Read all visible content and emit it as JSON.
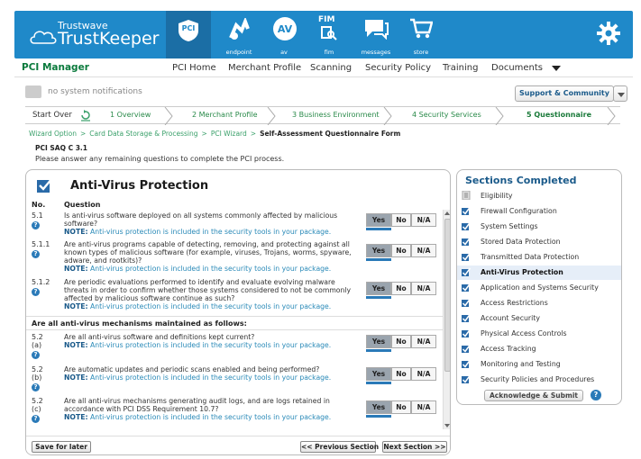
{
  "header": {
    "logo_line1": "Trustwave",
    "logo_line2": "TrustKeeper",
    "nav_icons": [
      {
        "label": "",
        "icon": "pci-shield-icon"
      },
      {
        "label": "endpoint",
        "icon": "endpoint-icon"
      },
      {
        "label": "av",
        "icon": "av-icon"
      },
      {
        "label": "fim",
        "icon": "fim-icon"
      },
      {
        "label": "messages",
        "icon": "messages-icon"
      },
      {
        "label": "store",
        "icon": "cart-icon"
      }
    ],
    "pci_text": "PCI",
    "av_text": "AV",
    "fim_text": "FIM"
  },
  "mainnav": {
    "brand": "PCI Manager",
    "items": [
      "PCI Home",
      "Merchant Profile",
      "Scanning",
      "Security Policy",
      "Training",
      "Documents"
    ]
  },
  "notifications": {
    "text": "no system notifications",
    "support_label": "Support & Community"
  },
  "steps": {
    "start_over": "Start Over",
    "items": [
      "1 Overview",
      "2 Merchant Profile",
      "3 Business Environment",
      "4 Security Services",
      "5 Questionnaire"
    ]
  },
  "crumbs": {
    "items": [
      "Wizard Option",
      "Card Data Storage & Processing",
      "PCI Wizard"
    ],
    "current": "Self-Assessment Questionnaire Form"
  },
  "saq_label": "PCI SAQ C 3.1",
  "instructions": "Please answer any remaining questions to complete the PCI process.",
  "questions_panel": {
    "title": "Anti-Virus Protection",
    "col_no": "No.",
    "col_question": "Question",
    "subheading": "Are all anti-virus mechanisms maintained as follows:",
    "note_label": "NOTE:",
    "answer_labels": [
      "Yes",
      "No",
      "N/A"
    ],
    "questions": [
      {
        "num": "5.1",
        "text": "Is anti-virus software deployed on all systems commonly affected by malicious software?",
        "note": "Anti-virus protection is included in the security tools in your package.",
        "selected": "Yes"
      },
      {
        "num": "5.1.1",
        "text": "Are anti-virus programs capable of detecting, removing, and protecting against all known types of malicious software (for example, viruses, Trojans, worms, spyware, adware, and rootkits)?",
        "note": "Anti-virus protection is included in the security tools in your package.",
        "selected": "Yes"
      },
      {
        "num": "5.1.2",
        "text": "Are periodic evaluations performed to identify and evaluate evolving malware threats in order to confirm whether those systems considered to not be commonly affected by malicious software continue as such?",
        "note": "Anti-virus protection is included in the security tools in your package.",
        "selected": "Yes"
      },
      {
        "num": "5.2\n(a)",
        "text": "Are all anti-virus software and definitions kept current?",
        "note": "Anti-virus protection is included in the security tools in your package.",
        "selected": "Yes"
      },
      {
        "num": "5.2\n(b)",
        "text": "Are automatic updates and periodic scans enabled and being performed?",
        "note": "Anti-virus protection is included in the security tools in your package.",
        "selected": "Yes"
      },
      {
        "num": "5.2\n(c)",
        "text": "Are all anti-virus mechanisms generating audit logs, and are logs retained in accordance with PCI DSS Requirement 10.7?",
        "note": "Anti-virus protection is included in the security tools in your package.",
        "selected": "Yes"
      }
    ],
    "save_label": "Save for later",
    "prev_label": "<< Previous Section",
    "next_label": "Next Section >>"
  },
  "sections_panel": {
    "title": "Sections Completed",
    "items": [
      {
        "label": "Eligibility",
        "state": "doc"
      },
      {
        "label": "Firewall Configuration",
        "state": "done"
      },
      {
        "label": "System Settings",
        "state": "done"
      },
      {
        "label": "Stored Data Protection",
        "state": "done"
      },
      {
        "label": "Transmitted Data Protection",
        "state": "done"
      },
      {
        "label": "Anti-Virus Protection",
        "state": "active"
      },
      {
        "label": "Application and Systems Security",
        "state": "done"
      },
      {
        "label": "Access Restrictions",
        "state": "done"
      },
      {
        "label": "Account Security",
        "state": "done"
      },
      {
        "label": "Physical Access Controls",
        "state": "done"
      },
      {
        "label": "Access Tracking",
        "state": "done"
      },
      {
        "label": "Monitoring and Testing",
        "state": "done"
      },
      {
        "label": "Security Policies and Procedures",
        "state": "done"
      }
    ],
    "ack_label": "Acknowledge & Submit"
  },
  "colors": {
    "header_blue": "#1f89c9",
    "brand_green": "#0a7a3c",
    "link_green": "#3aa06a",
    "note_blue": "#2a8ab8"
  }
}
